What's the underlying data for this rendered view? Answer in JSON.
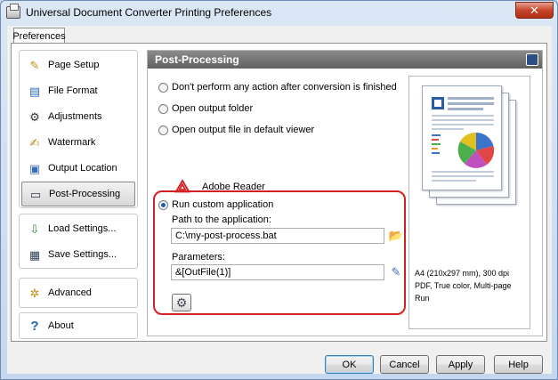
{
  "window": {
    "title": "Universal Document Converter Printing Preferences",
    "close_glyph": "✕"
  },
  "tabs": [
    {
      "label": "Preferences"
    }
  ],
  "sidebar": {
    "group1": [
      {
        "label": "Page Setup",
        "icon": "page-setup-icon",
        "glyph": "✎",
        "color": "#c58a1d"
      },
      {
        "label": "File Format",
        "icon": "file-format-icon",
        "glyph": "▤",
        "color": "#2d6bbd"
      },
      {
        "label": "Adjustments",
        "icon": "adjustments-icon",
        "glyph": "⚙",
        "color": "#333"
      },
      {
        "label": "Watermark",
        "icon": "watermark-icon",
        "glyph": "✍",
        "color": "#b9871a"
      },
      {
        "label": "Output Location",
        "icon": "output-location-icon",
        "glyph": "▣",
        "color": "#3a6bb5"
      },
      {
        "label": "Post-Processing",
        "icon": "post-processing-icon",
        "glyph": "▭",
        "color": "#335"
      }
    ],
    "group2": [
      {
        "label": "Load Settings...",
        "icon": "load-settings-icon",
        "glyph": "⇩",
        "color": "#2f7d2f"
      },
      {
        "label": "Save Settings...",
        "icon": "save-settings-icon",
        "glyph": "▦",
        "color": "#345"
      }
    ],
    "group3": [
      {
        "label": "Advanced",
        "icon": "advanced-icon",
        "glyph": "✲",
        "color": "#c08a12"
      }
    ],
    "group4": [
      {
        "label": "About",
        "icon": "about-icon",
        "glyph": "?",
        "color": "#2a61b8"
      }
    ]
  },
  "content": {
    "title": "Post-Processing",
    "options": [
      {
        "label": "Don't perform any action after conversion is finished",
        "checked": false
      },
      {
        "label": "Open output folder",
        "checked": false
      },
      {
        "label": "Open output file in default viewer",
        "checked": false
      },
      {
        "label": "Run custom application",
        "checked": true
      }
    ],
    "viewer": {
      "label": "Adobe Reader",
      "glyph": "⟁"
    },
    "path_label": "Path to the application:",
    "path_value": "C:\\my-post-process.bat",
    "params_label": "Parameters:",
    "params_value": "&[OutFile(1)]",
    "folder_glyph": "📂",
    "edit_glyph": "✎",
    "gear_glyph": "⚙"
  },
  "preview": {
    "info_line1": "A4 (210x297 mm), 300 dpi",
    "info_line2": "PDF, True color, Multi-page",
    "info_line3": "Run"
  },
  "buttons": {
    "ok": "OK",
    "cancel": "Cancel",
    "apply": "Apply",
    "help": "Help"
  }
}
